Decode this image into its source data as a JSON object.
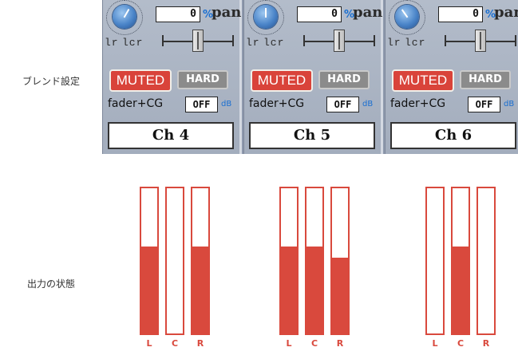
{
  "labels": {
    "blend": "ブレンド設定",
    "output": "出力の状態"
  },
  "strips": [
    {
      "pan_value": "0",
      "percent": "%",
      "pan": "pan",
      "lr": "lr",
      "lcr": "lcr",
      "muted": "MUTED",
      "hard": "HARD",
      "fader": "fader+CG",
      "fader_value": "OFF",
      "db": "dB",
      "channel": "Ch 4"
    },
    {
      "pan_value": "0",
      "percent": "%",
      "pan": "pan",
      "lr": "lr",
      "lcr": "lcr",
      "muted": "MUTED",
      "hard": "HARD",
      "fader": "fader+CG",
      "fader_value": "OFF",
      "db": "dB",
      "channel": "Ch 5"
    },
    {
      "pan_value": "0",
      "percent": "%",
      "pan": "pan",
      "lr": "lr",
      "lcr": "lcr",
      "muted": "MUTED",
      "hard": "HARD",
      "fader": "fader+CG",
      "fader_value": "OFF",
      "db": "dB",
      "channel": "Ch 6"
    }
  ],
  "meters": [
    {
      "channels": [
        {
          "label": "L",
          "level": 0.6
        },
        {
          "label": "C",
          "level": 0.0
        },
        {
          "label": "R",
          "level": 0.6
        }
      ]
    },
    {
      "channels": [
        {
          "label": "L",
          "level": 0.6
        },
        {
          "label": "C",
          "level": 0.6
        },
        {
          "label": "R",
          "level": 0.52
        }
      ]
    },
    {
      "channels": [
        {
          "label": "L",
          "level": 0.0
        },
        {
          "label": "C",
          "level": 0.6
        },
        {
          "label": "R",
          "level": 0.0
        }
      ]
    }
  ],
  "colors": {
    "muted": "#d9433a",
    "meter": "#d9493d",
    "accent": "#1a6fd1"
  }
}
